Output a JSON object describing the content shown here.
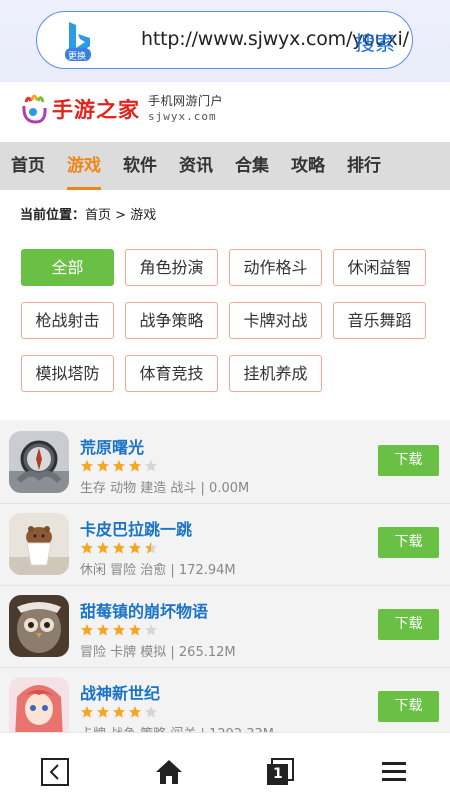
{
  "browser": {
    "url": "http://www.sjwyx.com/youxi/",
    "search_label": "搜索",
    "engine_badge": "更换"
  },
  "site": {
    "logo_text": "手游之家",
    "logo_sub_cn": "手机网游门户",
    "logo_sub_en": "sjwyx.com"
  },
  "nav": {
    "items": [
      {
        "label": "首页"
      },
      {
        "label": "游戏"
      },
      {
        "label": "软件"
      },
      {
        "label": "资讯"
      },
      {
        "label": "合集"
      },
      {
        "label": "攻略"
      },
      {
        "label": "排行"
      }
    ],
    "active_index": 1
  },
  "breadcrumb": {
    "label": "当前位置：",
    "home": "首页",
    "sep": " > ",
    "current": "游戏"
  },
  "categories": [
    {
      "label": "全部",
      "active": true
    },
    {
      "label": "角色扮演"
    },
    {
      "label": "动作格斗"
    },
    {
      "label": "休闲益智"
    },
    {
      "label": "枪战射击"
    },
    {
      "label": "战争策略"
    },
    {
      "label": "卡牌对战"
    },
    {
      "label": "音乐舞蹈"
    },
    {
      "label": "模拟塔防"
    },
    {
      "label": "体育竞技"
    },
    {
      "label": "挂机养成"
    }
  ],
  "games": [
    {
      "name": "荒原曙光",
      "rating": 4,
      "meta": "生存 动物 建造 战斗 | 0.00M",
      "download": "下载"
    },
    {
      "name": "卡皮巴拉跳一跳",
      "rating": 4.5,
      "meta": "休闲 冒险 治愈 | 172.94M",
      "download": "下载"
    },
    {
      "name": "甜莓镇的崩坏物语",
      "rating": 4,
      "meta": "冒险 卡牌 模拟 | 265.12M",
      "download": "下载"
    },
    {
      "name": "战神新世纪",
      "rating": 4,
      "meta": "卡牌 战争 策略 闯关 | 1292.33M",
      "download": "下载"
    }
  ],
  "colors": {
    "accent_orange": "#f08519",
    "green": "#6abf45",
    "link_blue": "#1a73c9",
    "star": "#f5a623"
  },
  "bottom_bar": {
    "icons": [
      "back-icon",
      "home-icon",
      "tabs-icon",
      "menu-icon"
    ],
    "tab_count": "1"
  }
}
